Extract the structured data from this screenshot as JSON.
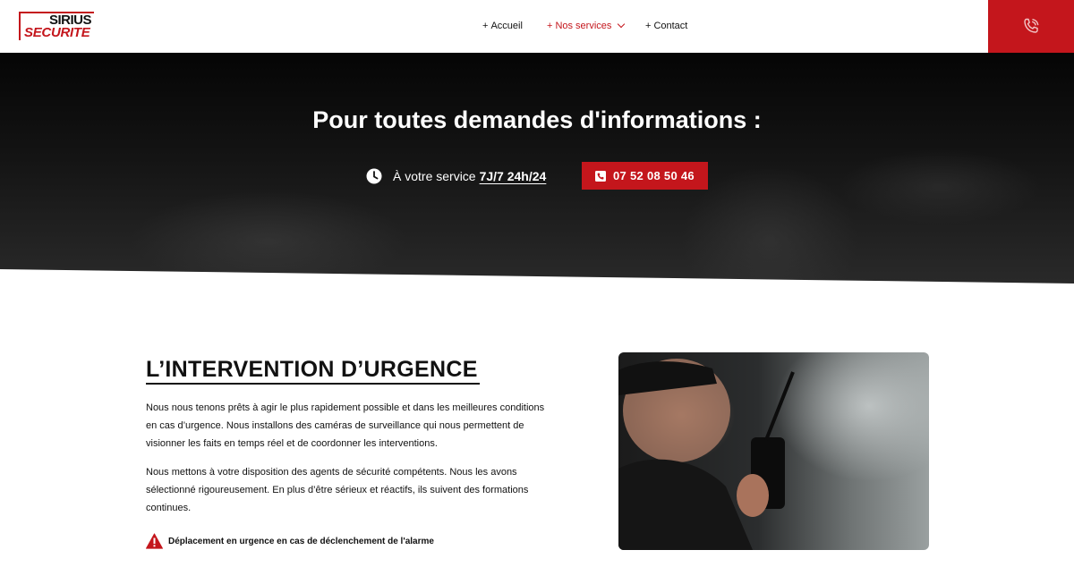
{
  "brand": {
    "name_line1": "SIRIUS",
    "name_line2": "SECURITE",
    "accent_color": "#c4161c"
  },
  "nav": {
    "items": [
      {
        "label": "Accueil",
        "prefix": "+"
      },
      {
        "label": "Nos services",
        "prefix": "+",
        "has_dropdown": true,
        "active": true
      },
      {
        "label": "Contact",
        "prefix": "+"
      }
    ],
    "phone_icon": "phone-ringing-icon"
  },
  "hero": {
    "title": "Pour toutes demandes d'informations :",
    "service_text": "À votre service",
    "service_hours": "7J/7 24h/24",
    "clock_icon": "clock-icon",
    "call_button": {
      "label": "07 52 08 50 46",
      "icon": "phone-square-icon"
    }
  },
  "section": {
    "title": "L’INTERVENTION D’URGENCE",
    "paragraphs": [
      "Nous nous tenons prêts à agir le plus rapidement possible et dans les meilleures conditions en cas d’urgence. Nous installons des caméras de surveillance qui nous permettent de visionner les faits en temps réel et de coordonner les interventions.",
      "Nous mettons à votre disposition des agents de sécurité compétents. Nous les avons sélectionné rigoureusement. En plus d’être sérieux et réactifs, ils suivent des formations continues."
    ],
    "alert": {
      "icon": "warning-icon",
      "text": "Déplacement en urgence en cas de déclenchement de l'alarme"
    },
    "photo_alt": "security-guard-with-walkie-talkie"
  }
}
